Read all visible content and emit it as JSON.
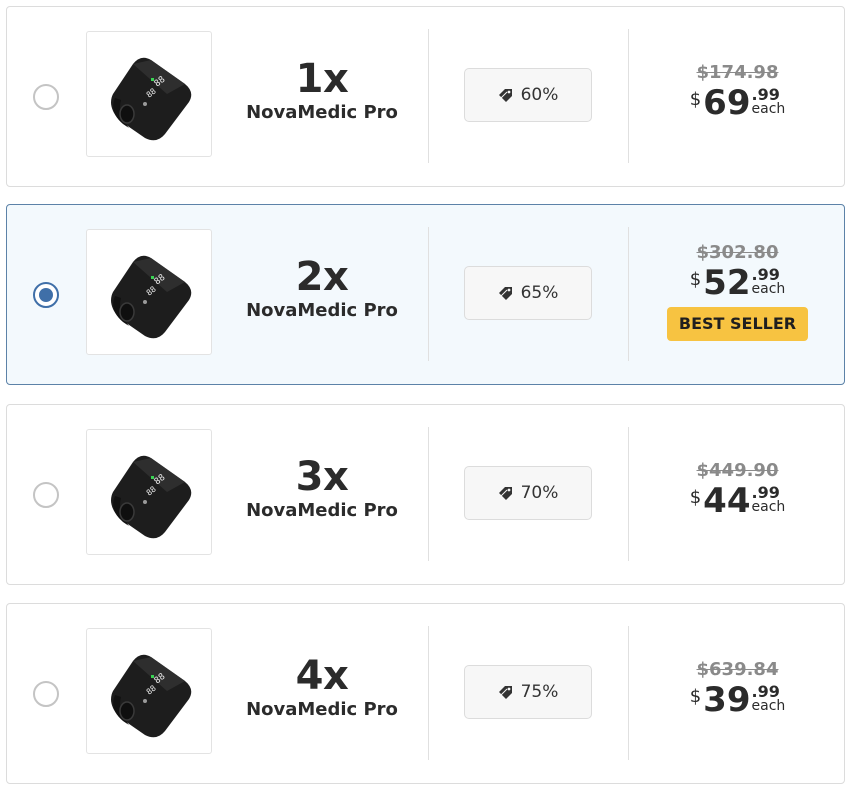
{
  "product_name": "NovaMedic Pro",
  "colors": {
    "selected_border": "#5c82a8",
    "selected_bg": "#f3f9fd",
    "radio_accent": "#3f6fa8",
    "badge_bg": "#f7c341"
  },
  "icons": {
    "discount": "price-tag-icon",
    "radio": "radio-button",
    "product": "blood-pressure-monitor-image"
  },
  "options": [
    {
      "qty": "1x",
      "name": "NovaMedic Pro",
      "discount": "60%",
      "original_price": "$174.98",
      "currency": "$",
      "dollars": "69",
      "cents": ".99",
      "unit": "each",
      "selected": false,
      "badge": ""
    },
    {
      "qty": "2x",
      "name": "NovaMedic Pro",
      "discount": "65%",
      "original_price": "$302.80",
      "currency": "$",
      "dollars": "52",
      "cents": ".99",
      "unit": "each",
      "selected": true,
      "badge": "BEST SELLER"
    },
    {
      "qty": "3x",
      "name": "NovaMedic Pro",
      "discount": "70%",
      "original_price": "$449.90",
      "currency": "$",
      "dollars": "44",
      "cents": ".99",
      "unit": "each",
      "selected": false,
      "badge": ""
    },
    {
      "qty": "4x",
      "name": "NovaMedic Pro",
      "discount": "75%",
      "original_price": "$639.84",
      "currency": "$",
      "dollars": "39",
      "cents": ".99",
      "unit": "each",
      "selected": false,
      "badge": ""
    }
  ]
}
